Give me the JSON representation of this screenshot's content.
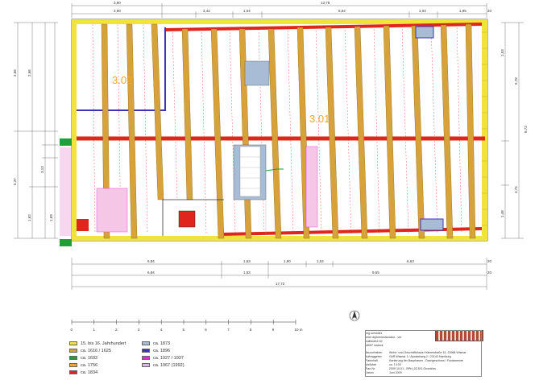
{
  "rooms": [
    {
      "id": "r1",
      "label": "3.02"
    },
    {
      "id": "r2",
      "label": "3.01"
    }
  ],
  "dims": {
    "top_overall": "13,78",
    "top_a": "3,90",
    "top_a2": "3,90",
    "top_b": "3,42",
    "top_c": "1,04",
    "top_d": "6,54",
    "top_e": "1,03",
    "top_f": "1,95",
    "top_end": "20",
    "bot_overall": "17,72",
    "bot_a": "6,84",
    "bot_b": "1,53",
    "bot_c": "1,90",
    "bot_d": "1,04",
    "bot_e": "6,63",
    "bot_end": "20",
    "bot2_a": "6,84",
    "bot2_b": "1,53",
    "bot2_c": "9,55",
    "bot2_end": "20",
    "left_a": "2,66",
    "left_b": "2,66",
    "left_c": "5,37",
    "left_d": "1,62",
    "left_e": "1,69",
    "left_f": "3,13",
    "right_a": "6,78",
    "right_b": "8,73",
    "right_c": "3,74",
    "right_d": "1,48",
    "right_e": "1,53"
  },
  "scale": {
    "ticks": [
      "0",
      "1",
      "2",
      "3",
      "4",
      "5",
      "6",
      "7",
      "8",
      "9",
      "10 m"
    ]
  },
  "legend": [
    {
      "color": "#f2e23c",
      "label": "15. bis 16. Jahrhundert"
    },
    {
      "color": "#d7a23a",
      "label": "ca. 1616 / 1625"
    },
    {
      "color": "#1f9e3a",
      "label": "ca. 1692"
    },
    {
      "color": "#f7a531",
      "label": "ca. 1756"
    },
    {
      "color": "#e0251c",
      "label": "ca. 1834"
    },
    {
      "color": "#a9bcd6",
      "label": "ca. 1873"
    },
    {
      "color": "#3b33b8",
      "label": "ca. 1896"
    },
    {
      "color": "#e22bd3",
      "label": "ca. 1927 / 1937"
    },
    {
      "color": "#d8b6e6",
      "label": "ca. 1967 (1992)"
    }
  ],
  "titleblock": {
    "author1": "jörg schröder",
    "author2": "freier diplomrestaurator - vdr",
    "author3": "wolfstraße 62",
    "author4": "18057 rostock",
    "k1": "Bauvorhaben",
    "v1": "Wohn- und Geschäftshaus Krämerstraße 16, 23966 Wismar",
    "k2": "Auftraggeber",
    "v2": "GbR Wismar 1 / Apostelweg 2 / 23143 Hamburg",
    "k3": "Planinhalt",
    "v3": "Kartierung der Bauphasen - Dachgeschoss / Fundamente",
    "k4": "Maßstab",
    "v4": "ca. 1:100",
    "k5": "Plan-Nr.",
    "v5": "2009 10-01 - BPH_03 DG-Grundriss",
    "k6": "Datum",
    "v6": "Juni 2009"
  }
}
